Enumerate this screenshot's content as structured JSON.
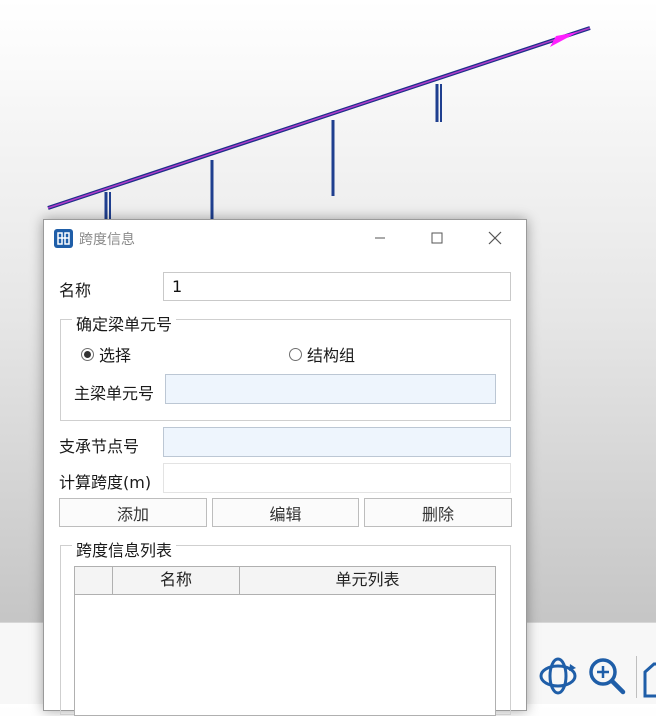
{
  "dialog": {
    "title": "跨度信息",
    "name_label": "名称",
    "name_value": "1",
    "beam_group": {
      "legend": "确定梁单元号",
      "radio_select": "选择",
      "radio_struct_group": "结构组",
      "main_beam_label": "主梁单元号",
      "main_beam_value": ""
    },
    "support_label": "支承节点号",
    "support_value": "",
    "span_label": "计算跨度(m)",
    "span_value": "",
    "buttons": {
      "add": "添加",
      "edit": "编辑",
      "delete": "删除"
    },
    "list_group": {
      "legend": "跨度信息列表",
      "columns": [
        "",
        "名称",
        "单元列表"
      ]
    }
  },
  "colors": {
    "beam": "#1d2f8a",
    "beam_highlight": "#b23cc9",
    "arrow": "#ff1fff",
    "support": "#1f3f8f",
    "icon_blue": "#1f5ea8"
  },
  "icons": [
    "app-icon",
    "minimize-icon",
    "maximize-icon",
    "close-icon",
    "rotate-view-icon",
    "zoom-in-icon",
    "view-box-icon"
  ]
}
